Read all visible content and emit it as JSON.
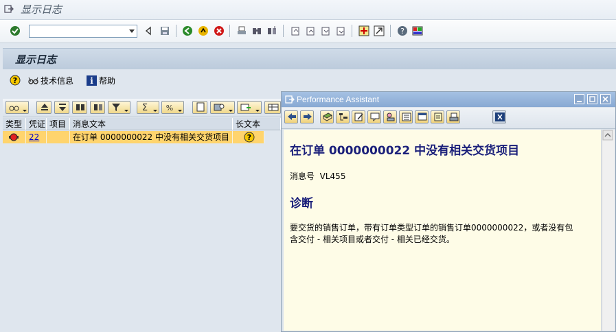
{
  "window": {
    "title": "显示日志"
  },
  "command_field": {
    "value": "",
    "placeholder": ""
  },
  "screen": {
    "title": "显示日志"
  },
  "app_toolbar": {
    "tech_info_label": "技术信息",
    "help_label": "帮助"
  },
  "log_table": {
    "columns": [
      "类型",
      "凭证",
      "项目",
      "消息文本",
      "长文本"
    ],
    "rows": [
      {
        "type_icon": "red-status-light-icon",
        "document": "22",
        "item": "",
        "message": "在订单 0000000022 中没有相关交货项目",
        "longtext_icon": "help-icon"
      }
    ]
  },
  "performance_assistant": {
    "title": "Performance Assistant",
    "heading": "在订单 0000000022 中没有相关交货项目",
    "message_no_label": "消息号",
    "message_no": "VL455",
    "diagnosis_heading": "诊断",
    "diagnosis_line1": "要交货的销售订单，带有订单类型订单的销售订单0000000022，或者没有包",
    "diagnosis_line2": "含交付 - 相关项目或者交付 - 相关已经交货。"
  },
  "colors": {
    "header_bg": "#bccbdc",
    "row_highlight": "#ffd46d",
    "pa_titlebar": "#88a9d3",
    "doc_bg": "#fefce7",
    "heading_text": "#1a1f7a"
  }
}
